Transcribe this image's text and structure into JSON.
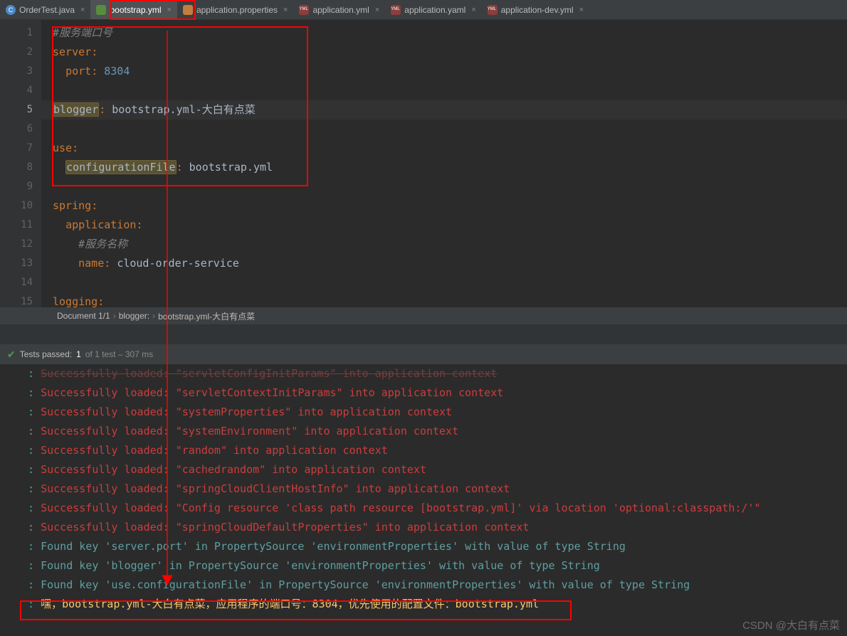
{
  "tabs": [
    {
      "label": "OrderTest.java",
      "active": false,
      "icon": "c"
    },
    {
      "label": "bootstrap.yml",
      "active": true,
      "icon": "yml"
    },
    {
      "label": "application.properties",
      "active": false,
      "icon": "prop"
    },
    {
      "label": "application.yml",
      "active": false,
      "icon": "yml2"
    },
    {
      "label": "application.yaml",
      "active": false,
      "icon": "yml2"
    },
    {
      "label": "application-dev.yml",
      "active": false,
      "icon": "yml2"
    }
  ],
  "editor": {
    "lines": {
      "l1_comment": "#服务端口号",
      "l2_key": "server",
      "l3_key": "port",
      "l3_val": "8304",
      "l5_key": "blogger",
      "l5_val": "bootstrap.yml-大白有点菜",
      "l7_key": "use",
      "l8_key": "configurationFile",
      "l8_val": "bootstrap.yml",
      "l10_key": "spring",
      "l11_key": "application",
      "l12_comment": "#服务名称",
      "l13_key": "name",
      "l13_val": "cloud-order-service",
      "l15_key": "logging"
    },
    "line_numbers": [
      "1",
      "2",
      "3",
      "4",
      "5",
      "6",
      "7",
      "8",
      "9",
      "10",
      "11",
      "12",
      "13",
      "14",
      "15"
    ]
  },
  "breadcrumb": {
    "p1": "Document 1/1",
    "p2": "blogger:",
    "p3": "bootstrap.yml-大白有点菜"
  },
  "test_status": {
    "label": "Tests passed:",
    "count": "1",
    "rest": "of 1 test – 307 ms"
  },
  "console": [
    {
      "colon": ":",
      "text": "Successfully loaded: \"servletConfigInitParams\" into application context",
      "cls": "strike"
    },
    {
      "colon": ":",
      "text": "Successfully loaded: \"servletContextInitParams\" into application context",
      "cls": "red-t"
    },
    {
      "colon": ":",
      "text": "Successfully loaded: \"systemProperties\" into application context",
      "cls": "red-t"
    },
    {
      "colon": ":",
      "text": "Successfully loaded: \"systemEnvironment\" into application context",
      "cls": "red-t"
    },
    {
      "colon": ":",
      "text": "Successfully loaded: \"random\" into application context",
      "cls": "red-t"
    },
    {
      "colon": ":",
      "text": "Successfully loaded: \"cachedrandom\" into application context",
      "cls": "red-t"
    },
    {
      "colon": ":",
      "text": "Successfully loaded: \"springCloudClientHostInfo\" into application context",
      "cls": "red-t"
    },
    {
      "colon": ":",
      "text": "Successfully loaded: \"Config resource 'class path resource [bootstrap.yml]' via location 'optional:classpath:/'\"",
      "cls": "red-t"
    },
    {
      "colon": ":",
      "text": "Successfully loaded: \"springCloudDefaultProperties\" into application context",
      "cls": "red-t"
    },
    {
      "colon": ":",
      "text": "Found key 'server.port' in PropertySource 'environmentProperties' with value of type String",
      "cls": "teal-t"
    },
    {
      "colon": ":",
      "text": "Found key 'blogger' in PropertySource 'environmentProperties' with value of type String",
      "cls": "teal-t"
    },
    {
      "colon": ":",
      "text": "Found key 'use.configurationFile' in PropertySource 'environmentProperties' with value of type String",
      "cls": "teal-t"
    },
    {
      "colon": ":",
      "text": "嘿，bootstrap.yml-大白有点菜，应用程序的端口号：8304，优先使用的配置文件：bootstrap.yml",
      "cls": "yellow-t"
    }
  ],
  "watermark": "CSDN @大白有点菜"
}
